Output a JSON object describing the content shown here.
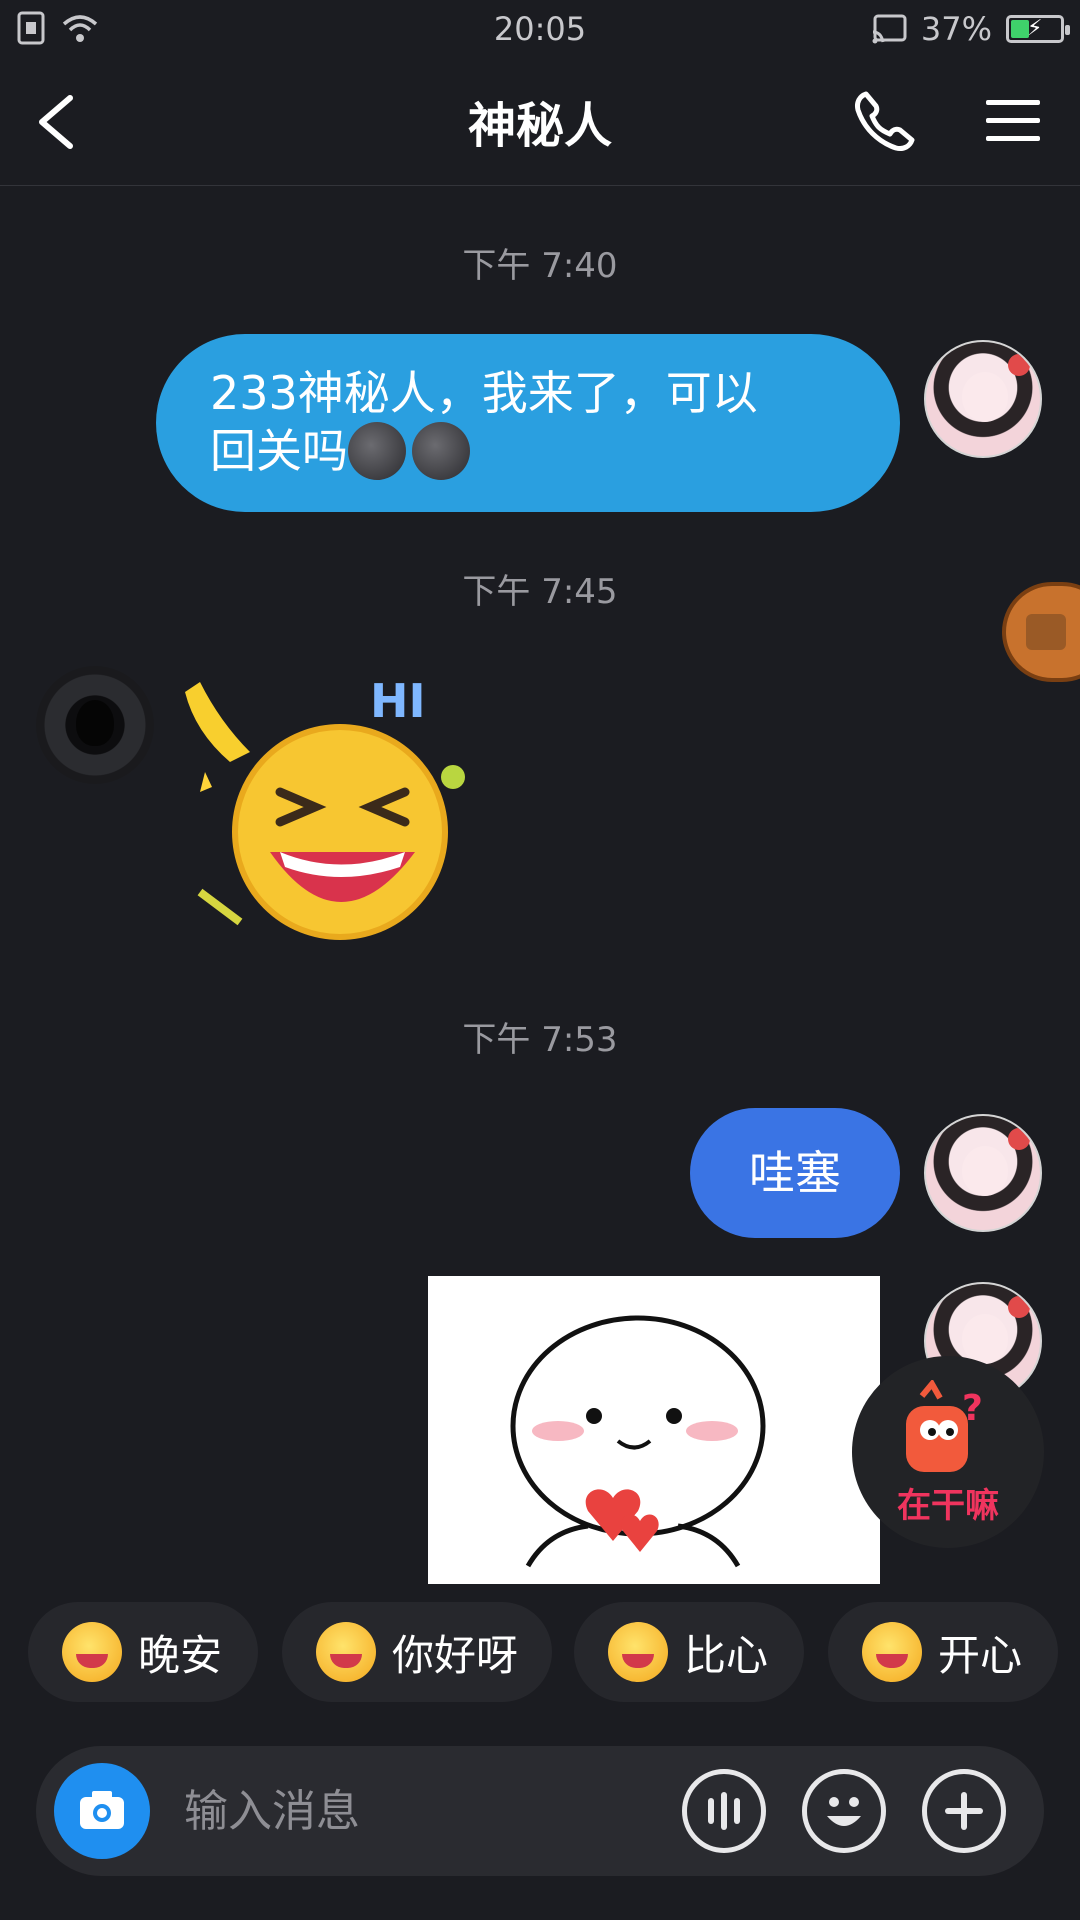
{
  "status_bar": {
    "time": "20:05",
    "battery": "37%",
    "battery_level": 0.37
  },
  "header": {
    "title": "神秘人"
  },
  "messages": {
    "time_1": "下午 7:40",
    "msg_1_line1": "233神秘人，我来了，可以",
    "msg_1_line2": "回关吗",
    "time_2": "下午 7:45",
    "time_3": "下午 7:53",
    "msg_3": "哇塞"
  },
  "float": {
    "zgm_label": "在干嘛"
  },
  "quick_replies": [
    "晚安",
    "你好呀",
    "比心",
    "开心"
  ],
  "input": {
    "placeholder": "输入消息"
  },
  "colors": {
    "bg": "#1b1c21",
    "bubble_blue": "#2a9fe0",
    "bubble_blue2": "#3a74e4",
    "accent_pink": "#f0345e"
  }
}
